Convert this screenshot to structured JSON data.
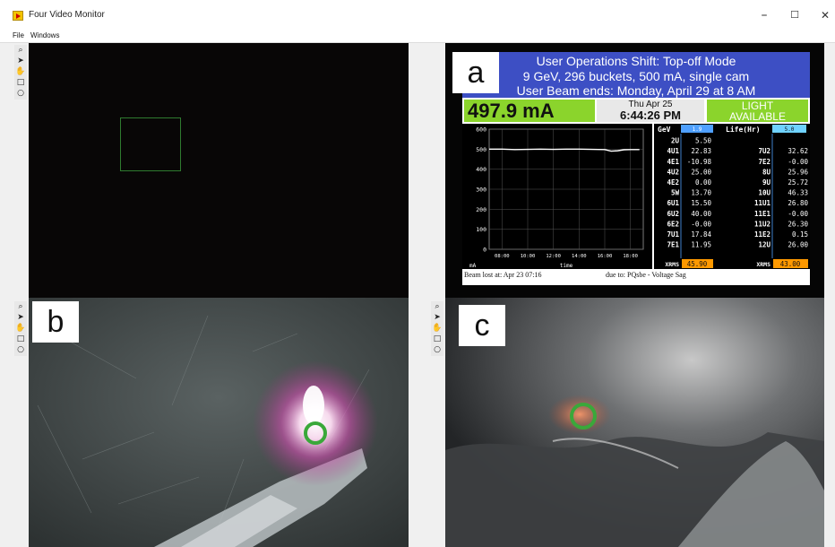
{
  "window": {
    "title": "Four Video Monitor",
    "minimize": "–",
    "maximize": "☐",
    "close": "✕"
  },
  "menu": [
    "File",
    "Windows"
  ],
  "tools": [
    "⌕",
    "➤",
    "✋",
    "□",
    "○"
  ],
  "panels": {
    "a": "a",
    "b": "b",
    "c": "c"
  },
  "status": {
    "line1": "User Operations Shift: Top-off Mode",
    "line2": "9 GeV, 296 buckets, 500 mA, single cam",
    "line3": "User Beam ends: Monday, April 29 at 8 AM",
    "current": "497.9 mA",
    "date": "Thu Apr 25",
    "time": "6:44:26 PM",
    "light1": "LIGHT",
    "light2": "AVAILABLE",
    "beam_lost": "Beam lost at: Apr 23 07:16",
    "due_to": "due to: PQsbe - Voltage Sag"
  },
  "chart_data": {
    "type": "line",
    "x_ticks": [
      "08:00",
      "10:00",
      "12:00",
      "14:00",
      "16:00",
      "18:00"
    ],
    "y_ticks": [
      "0",
      "100",
      "200",
      "300",
      "400",
      "500",
      "600"
    ],
    "ylim": [
      0,
      600
    ],
    "xlim": [
      7.0,
      19.0
    ],
    "ylabel": "mA",
    "xlabel": "time",
    "series": [
      {
        "x": [
          7.0,
          8.0,
          9.0,
          10.0,
          11.0,
          12.0,
          13.0,
          14.0,
          15.0,
          16.0,
          16.5,
          17.0,
          17.5,
          18.0,
          18.7
        ],
        "values": [
          500,
          500,
          498,
          499,
          500,
          499,
          500,
          500,
          499,
          498,
          490,
          492,
          497,
          498,
          498
        ]
      }
    ]
  },
  "table": {
    "left_header": "GeV",
    "left_header_value": "1.9",
    "right_header": "Life(Hr)",
    "right_header_value": "5.0",
    "left_rows": [
      [
        "2U",
        "5.50"
      ],
      [
        "4U1",
        "22.83"
      ],
      [
        "4E1",
        "-10.98"
      ],
      [
        "4U2",
        "25.00"
      ],
      [
        "4E2",
        "0.00"
      ],
      [
        "5W",
        "13.70"
      ],
      [
        "6U1",
        "15.50"
      ],
      [
        "6U2",
        "40.00"
      ],
      [
        "6E2",
        "-0.00"
      ],
      [
        "7U1",
        "17.84"
      ],
      [
        "7E1",
        "11.95"
      ]
    ],
    "right_rows": [
      [
        "",
        ""
      ],
      [
        "7U2",
        "32.62"
      ],
      [
        "7E2",
        "-0.00"
      ],
      [
        "8U",
        "25.96"
      ],
      [
        "9U",
        "25.72"
      ],
      [
        "10U",
        "46.33"
      ],
      [
        "11U1",
        "26.80"
      ],
      [
        "11E1",
        "-0.00"
      ],
      [
        "11U2",
        "26.30"
      ],
      [
        "11E2",
        "0.15"
      ],
      [
        "12U",
        "26.00"
      ]
    ],
    "xrms_label": "XRMS",
    "xrms_left": "45.90",
    "xrms_right": "43.00"
  },
  "colors": {
    "header_blue": "#3d4fc4",
    "status_green": "#8bd42c",
    "roi_green": "#2f7a2f",
    "marker_green": "#3aa83a",
    "xrms_orange": "#ff9900"
  }
}
